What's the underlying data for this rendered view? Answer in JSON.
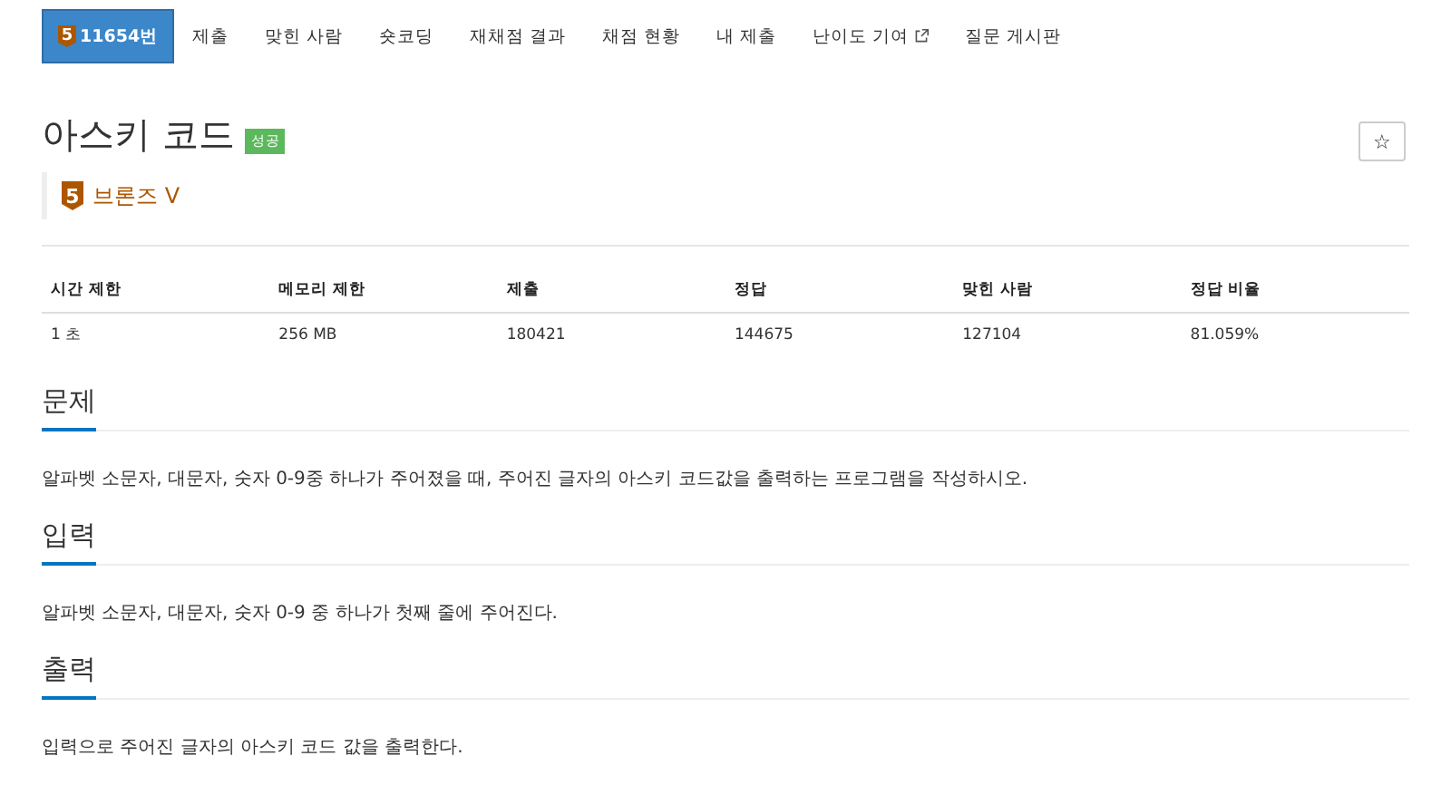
{
  "tabs": [
    {
      "label": "11654번",
      "tier": "5",
      "selected": true,
      "external": false
    },
    {
      "label": "제출",
      "selected": false,
      "external": false
    },
    {
      "label": "맞힌 사람",
      "selected": false,
      "external": false
    },
    {
      "label": "숏코딩",
      "selected": false,
      "external": false
    },
    {
      "label": "재채점 결과",
      "selected": false,
      "external": false
    },
    {
      "label": "채점 현황",
      "selected": false,
      "external": false
    },
    {
      "label": "내 제출",
      "selected": false,
      "external": false
    },
    {
      "label": "난이도 기여",
      "selected": false,
      "external": true
    },
    {
      "label": "질문 게시판",
      "selected": false,
      "external": false
    }
  ],
  "title": "아스키 코드",
  "status_label": "성공",
  "star_button": "☆",
  "tier": {
    "level": "5",
    "name": "브론즈 V"
  },
  "table": {
    "columns": [
      "시간 제한",
      "메모리 제한",
      "제출",
      "정답",
      "맞힌 사람",
      "정답 비율"
    ],
    "rows": [
      [
        "1 초",
        "256 MB",
        "180421",
        "144675",
        "127104",
        "81.059%"
      ]
    ]
  },
  "sections": [
    {
      "heading": "문제",
      "body": "알파벳 소문자, 대문자, 숫자 0-9중 하나가 주어졌을 때, 주어진 글자의 아스키 코드값을 출력하는 프로그램을 작성하시오."
    },
    {
      "heading": "입력",
      "body": "알파벳 소문자, 대문자, 숫자 0-9 중 하나가 첫째 줄에 주어진다."
    },
    {
      "heading": "출력",
      "body": "입력으로 주어진 글자의 아스키 코드 값을 출력한다."
    }
  ]
}
